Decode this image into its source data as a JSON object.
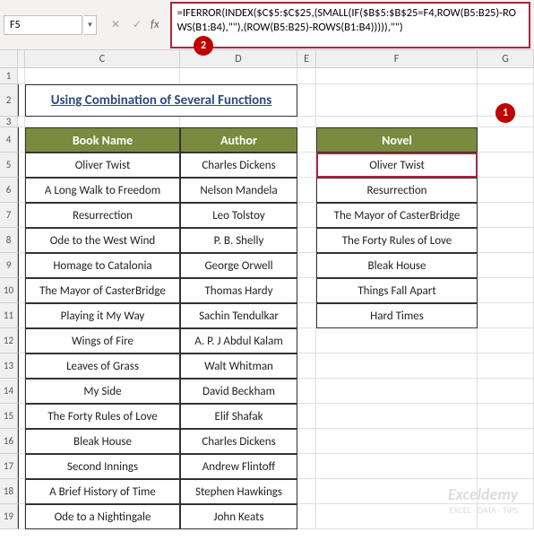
{
  "namebox": {
    "ref": "F5"
  },
  "formula": "=IFERROR(INDEX($C$5:$C$25,(SMALL(IF($B$5:$B$25=F4,ROW(B5:B25)-ROWS(B1:B4),\"\"),(ROW(B5:B25)-ROWS(B1:B4))))),\"\")",
  "callouts": {
    "one": "1",
    "two": "2"
  },
  "columns": {
    "C": "C",
    "D": "D",
    "E": "E",
    "F": "F",
    "G": "G"
  },
  "title": "Using Combination of Several Functions",
  "headers": {
    "book": "Book Name",
    "author": "Author",
    "novel": "Novel"
  },
  "rows": [
    {
      "n": "1"
    },
    {
      "n": "2"
    },
    {
      "n": "3"
    },
    {
      "n": "4"
    },
    {
      "n": "5"
    },
    {
      "n": "6"
    },
    {
      "n": "7"
    },
    {
      "n": "8"
    },
    {
      "n": "9"
    },
    {
      "n": "10"
    },
    {
      "n": "11"
    },
    {
      "n": "12"
    },
    {
      "n": "13"
    },
    {
      "n": "14"
    },
    {
      "n": "15"
    },
    {
      "n": "16"
    },
    {
      "n": "17"
    },
    {
      "n": "18"
    },
    {
      "n": "19"
    }
  ],
  "data": [
    {
      "book": "Oliver Twist",
      "author": "Charles Dickens",
      "novel": "Oliver Twist"
    },
    {
      "book": "A Long Walk to Freedom",
      "author": "Nelson Mandela",
      "novel": "Resurrection"
    },
    {
      "book": "Resurrection",
      "author": "Leo Tolstoy",
      "novel": "The Mayor of CasterBridge"
    },
    {
      "book": "Ode to the West Wind",
      "author": "P. B. Shelly",
      "novel": "The Forty Rules of Love"
    },
    {
      "book": "Homage to Catalonia",
      "author": "George Orwell",
      "novel": "Bleak House"
    },
    {
      "book": "The Mayor of CasterBridge",
      "author": "Thomas Hardy",
      "novel": "Things Fall Apart"
    },
    {
      "book": "Playing it My Way",
      "author": "Sachin Tendulkar",
      "novel": "Hard Times"
    },
    {
      "book": "Wings of Fire",
      "author": "A. P. J Abdul Kalam",
      "novel": ""
    },
    {
      "book": "Leaves of Grass",
      "author": "Walt Whitman",
      "novel": ""
    },
    {
      "book": "My Side",
      "author": "David Beckham",
      "novel": ""
    },
    {
      "book": "The Forty Rules of Love",
      "author": "Elif Shafak",
      "novel": ""
    },
    {
      "book": "Bleak House",
      "author": "Charles Dickens",
      "novel": ""
    },
    {
      "book": "Second Innings",
      "author": "Andrew Flintoff",
      "novel": ""
    },
    {
      "book": "A Brief History of Time",
      "author": "Stephen Hawkings",
      "novel": ""
    },
    {
      "book": "Ode to a Nightingale",
      "author": "John Keats",
      "novel": ""
    }
  ],
  "watermark": {
    "big": "Exceldemy",
    "small": "EXCEL · DATA · TIPS"
  }
}
